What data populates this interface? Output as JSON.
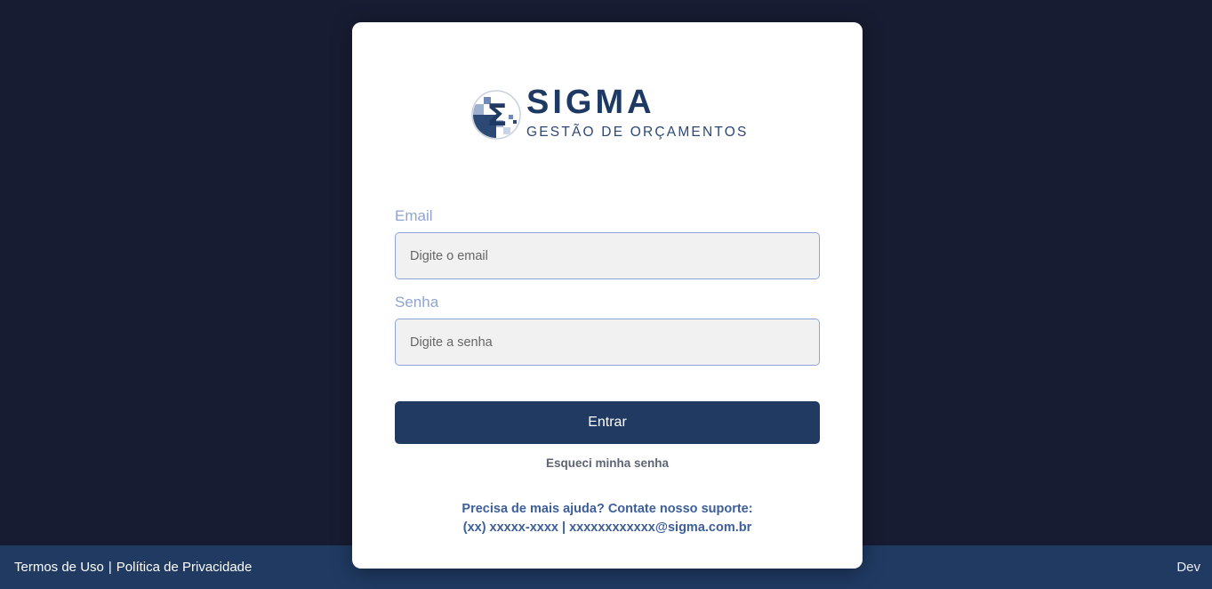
{
  "logo": {
    "title": "SIGMA",
    "subtitle": "GESTÃO DE ORÇAMENTOS",
    "symbol": "Σ"
  },
  "form": {
    "email_label": "Email",
    "email_placeholder": "Digite o email",
    "password_label": "Senha",
    "password_placeholder": "Digite a senha",
    "submit_label": "Entrar",
    "forgot_label": "Esqueci minha senha"
  },
  "support": {
    "line1": "Precisa de mais ajuda? Contate nosso suporte:",
    "line2": "(xx) xxxxx-xxxx | xxxxxxxxxxxx@sigma.com.br"
  },
  "footer": {
    "terms_label": "Termos de Uso",
    "separator": "|",
    "privacy_label": "Política de Privacidade",
    "environment": "Dev"
  },
  "colors": {
    "background": "#181c32",
    "brand_navy": "#203a62",
    "label_blue": "#90a4cf",
    "support_blue": "#3d5f99"
  },
  "icons": {
    "logo": "sigma-logo-icon"
  }
}
